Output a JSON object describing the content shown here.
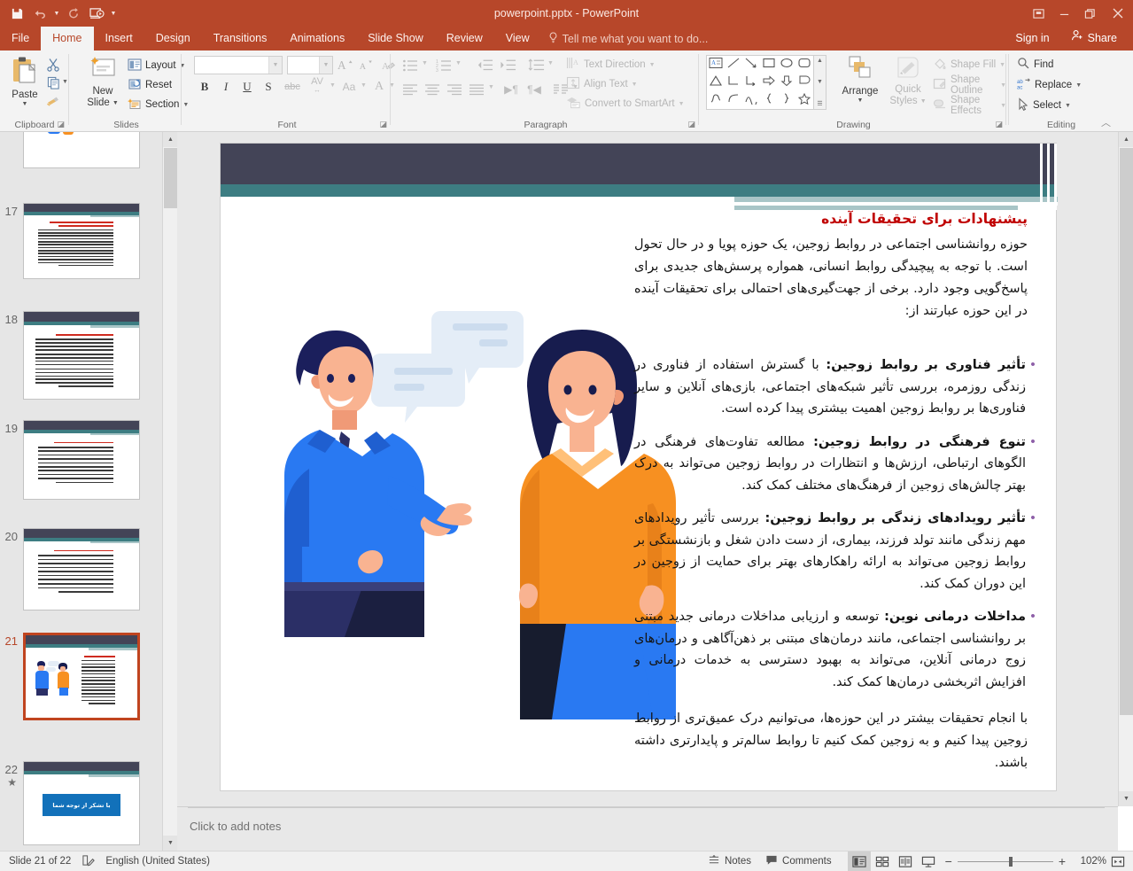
{
  "app": {
    "title": "powerpoint.pptx - PowerPoint",
    "sign_in": "Sign in",
    "share": "Share",
    "accent_color": "#b7472a"
  },
  "quick_access": [
    {
      "name": "save-icon",
      "label": "Save"
    },
    {
      "name": "undo-icon",
      "label": "Undo"
    },
    {
      "name": "redo-icon",
      "label": "Redo"
    },
    {
      "name": "start-presentation-icon",
      "label": "Start From Beginning"
    },
    {
      "name": "customize-qat-icon",
      "label": "Customize Quick Access Toolbar"
    }
  ],
  "window_controls": [
    {
      "name": "ribbon-display-options-icon",
      "label": "Ribbon Display Options"
    },
    {
      "name": "minimize-icon",
      "label": "Minimize"
    },
    {
      "name": "restore-icon",
      "label": "Restore Down"
    },
    {
      "name": "close-icon",
      "label": "Close"
    }
  ],
  "tabs": [
    {
      "label": "File",
      "active": false
    },
    {
      "label": "Home",
      "active": true
    },
    {
      "label": "Insert",
      "active": false
    },
    {
      "label": "Design",
      "active": false
    },
    {
      "label": "Transitions",
      "active": false
    },
    {
      "label": "Animations",
      "active": false
    },
    {
      "label": "Slide Show",
      "active": false
    },
    {
      "label": "Review",
      "active": false
    },
    {
      "label": "View",
      "active": false
    }
  ],
  "tell_me": "Tell me what you want to do...",
  "ribbon": {
    "clipboard": {
      "group_label": "Clipboard",
      "paste": "Paste",
      "cut": "Cut",
      "copy": "Copy",
      "format_painter": "Format Painter"
    },
    "slides": {
      "group_label": "Slides",
      "new_slide": "New\nSlide",
      "new_slide_line1": "New",
      "new_slide_line2": "Slide",
      "layout": "Layout",
      "reset": "Reset",
      "section": "Section"
    },
    "font": {
      "group_label": "Font",
      "font_name_value": "",
      "font_size_value": "",
      "increase_size": "A",
      "decrease_size": "A",
      "clear_formatting": "Clear All Formatting",
      "bold": "B",
      "italic": "I",
      "underline": "U",
      "shadow": "S",
      "strikethrough": "abc",
      "character_spacing": "AV",
      "change_case": "Aa",
      "font_color": "A"
    },
    "paragraph": {
      "group_label": "Paragraph",
      "text_direction": "Text Direction",
      "align_text": "Align Text",
      "convert_to_smartart": "Convert to SmartArt"
    },
    "drawing": {
      "group_label": "Drawing",
      "arrange": "Arrange",
      "quick_styles_line1": "Quick",
      "quick_styles_line2": "Styles",
      "shape_fill": "Shape Fill",
      "shape_outline": "Shape Outline",
      "shape_effects": "Shape Effects"
    },
    "editing": {
      "group_label": "Editing",
      "find": "Find",
      "replace": "Replace",
      "select": "Select"
    }
  },
  "slide_panel": {
    "thumbnails": [
      {
        "number": "17",
        "selected": false,
        "has_animation": false,
        "kind": "text"
      },
      {
        "number": "18",
        "selected": false,
        "has_animation": false,
        "kind": "text"
      },
      {
        "number": "19",
        "selected": false,
        "has_animation": false,
        "kind": "text"
      },
      {
        "number": "20",
        "selected": false,
        "has_animation": false,
        "kind": "text"
      },
      {
        "number": "21",
        "selected": true,
        "has_animation": false,
        "kind": "illustration"
      },
      {
        "number": "22",
        "selected": false,
        "has_animation": true,
        "kind": "thanks",
        "box_text": "با تشکر از توجه شما"
      }
    ]
  },
  "slide": {
    "title": "پیشنهادات برای تحقیقات آینده",
    "title_color": "#c00000",
    "intro": "حوزه روانشناسی اجتماعی در روابط زوجین، یک حوزه پویا و در حال تحول است. با توجه به پیچیدگی روابط انسانی، همواره پرسش‌های جدیدی برای پاسخ‌گویی وجود دارد. برخی از جهت‌گیری‌های احتمالی برای تحقیقات آینده در این حوزه عبارتند از:",
    "bullets": [
      {
        "lead": "تأثیر فناوری بر روابط زوجین:",
        "body": " با گسترش استفاده از فناوری در زندگی روزمره، بررسی تأثیر شبکه‌های اجتماعی، بازی‌های آنلاین و سایر فناوری‌ها بر روابط زوجین اهمیت بیشتری پیدا کرده است."
      },
      {
        "lead": "تنوع فرهنگی در روابط زوجین:",
        "body": " مطالعه تفاوت‌های فرهنگی در الگوهای ارتباطی، ارزش‌ها و انتظارات در روابط زوجین می‌تواند به درک بهتر چالش‌های زوجین از فرهنگ‌های مختلف کمک کند."
      },
      {
        "lead": "تأثیر رویدادهای زندگی بر روابط زوجین:",
        "body": " بررسی تأثیر رویدادهای مهم زندگی مانند تولد فرزند، بیماری، از دست دادن شغل و بازنشستگی بر روابط زوجین می‌تواند به ارائه راهکارهای بهتر برای حمایت از زوجین در این دوران کمک کند."
      },
      {
        "lead": "مداخلات درمانی نوین:",
        "body": " توسعه و ارزیابی مداخلات درمانی جدید مبتنی بر روانشناسی اجتماعی، مانند درمان‌های مبتنی بر ذهن‌آگاهی و درمان‌های زوج درمانی آنلاین، می‌تواند به بهبود دسترسی به خدمات درمانی و افزایش اثربخشی درمان‌ها کمک کند."
      }
    ],
    "closing": "با انجام تحقیقات بیشتر در این حوزه‌ها، می‌توانیم درک عمیق‌تری از روابط زوجین پیدا کنیم و به زوجین کمک کنیم تا روابط سالم‌تر و پایدارتری داشته باشند.",
    "illustration": {
      "name": "two-people-conversation-illustration",
      "colors": {
        "man_suit": "#2979f2",
        "man_suit_dark": "#1f5fd0",
        "man_hair": "#1b1f5c",
        "man_trousers": "#2b2f66",
        "woman_sweater": "#f79021",
        "woman_hair": "#171c4e",
        "woman_skirt": "#2979f2",
        "skin": "#f9b391",
        "bubble": "#e4edf7"
      }
    },
    "theme_colors": {
      "navy_band": "#434457",
      "teal_band": "#3d7d82",
      "light_teal": "#a8c5c7"
    }
  },
  "notes": {
    "placeholder": "Click to add notes"
  },
  "status_bar": {
    "slide_counter": "Slide 21 of 22",
    "language": "English (United States)",
    "notes_button": "Notes",
    "comments_button": "Comments",
    "views": [
      {
        "name": "normal-view-button",
        "label": "Normal",
        "active": true
      },
      {
        "name": "slide-sorter-view-button",
        "label": "Slide Sorter",
        "active": false
      },
      {
        "name": "reading-view-button",
        "label": "Reading View",
        "active": false
      },
      {
        "name": "slide-show-button",
        "label": "Slide Show",
        "active": false
      }
    ],
    "zoom_out": "−",
    "zoom_in": "+",
    "zoom_level": "102%",
    "fit_to_window": "Fit slide to current window"
  }
}
